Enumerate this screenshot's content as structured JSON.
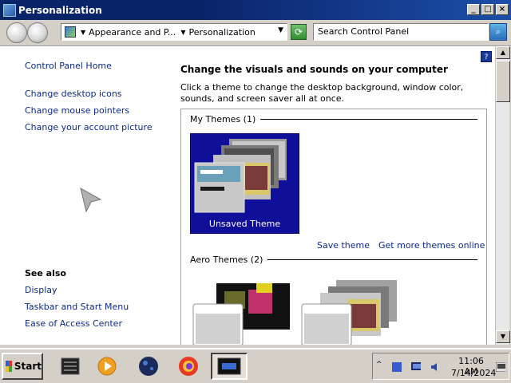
{
  "window": {
    "title": "Personalization",
    "controls": {
      "minimize": "_",
      "maximize": "□",
      "close": "×"
    }
  },
  "nav": {
    "breadcrumb_1": "Appearance and P...",
    "breadcrumb_2": "Personalization",
    "search_placeholder": "Search Control Panel"
  },
  "left_pane": {
    "home_link": "Control Panel Home",
    "tasks": [
      "Change desktop icons",
      "Change mouse pointers",
      "Change your account picture"
    ],
    "see_also_heading": "See also",
    "see_also": [
      "Display",
      "Taskbar and Start Menu",
      "Ease of Access Center"
    ]
  },
  "main": {
    "heading": "Change the visuals and sounds on your computer",
    "description": "Click a theme to change the desktop background, window color, sounds, and screen saver all at once.",
    "my_themes_label": "My Themes (1)",
    "unsaved_theme_label": "Unsaved Theme",
    "save_theme_link": "Save theme",
    "more_themes_link": "Get more themes online",
    "aero_themes_label": "Aero Themes (2)"
  },
  "taskbar": {
    "start_label": "Start",
    "clock_time": "11:06 AM",
    "clock_date": "7/14/2024"
  },
  "icons": {
    "app": "control-panel-icon",
    "help": "help-icon",
    "refresh": "refresh-icon",
    "search": "search-icon"
  },
  "colors": {
    "title_bar": "#0a246a",
    "link": "#0a2a8a",
    "selected_theme_bg": "#0f0f9a"
  }
}
